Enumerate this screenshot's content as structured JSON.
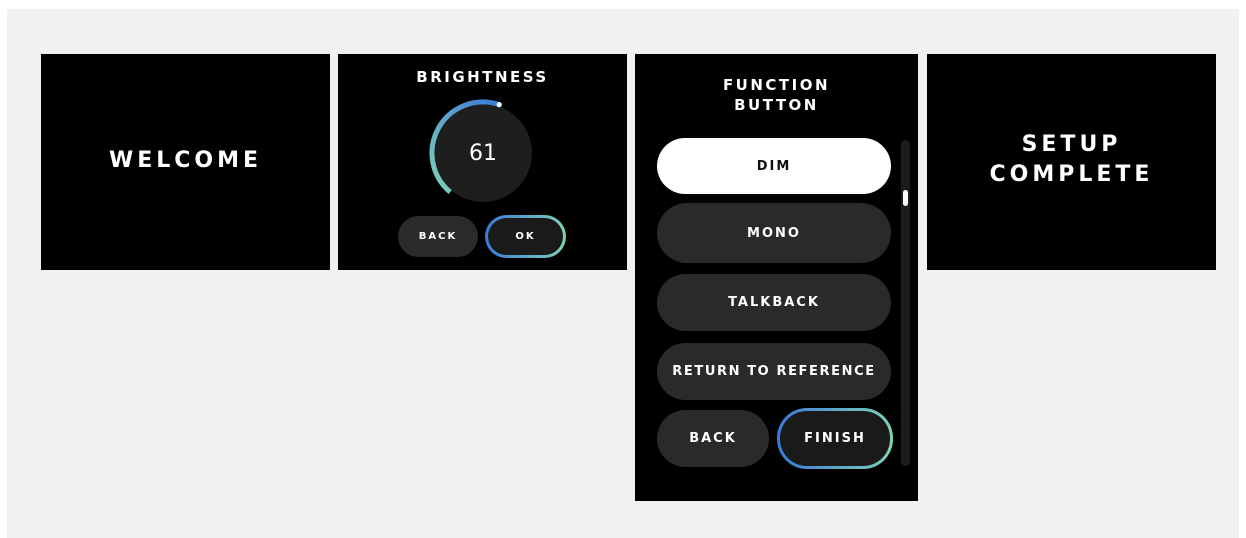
{
  "welcome": {
    "title": "WELCOME"
  },
  "brightness": {
    "title": "BRIGHTNESS",
    "value": "61",
    "back_label": "BACK",
    "ok_label": "OK",
    "level_percent": 61
  },
  "function_button": {
    "title_line1": "FUNCTION",
    "title_line2": "BUTTON",
    "options": [
      {
        "label": "DIM",
        "selected": true
      },
      {
        "label": "MONO",
        "selected": false
      },
      {
        "label": "TALKBACK",
        "selected": false
      },
      {
        "label": "RETURN TO REFERENCE",
        "selected": false
      }
    ],
    "back_label": "BACK",
    "finish_label": "FINISH"
  },
  "complete": {
    "title_line1": "SETUP",
    "title_line2": "COMPLETE"
  },
  "colors": {
    "background": "#f1f1f1",
    "screen": "#000000",
    "pill": "#2a2a2a",
    "accent_start": "#3a7ad9",
    "accent_end": "#7fd1b9"
  }
}
